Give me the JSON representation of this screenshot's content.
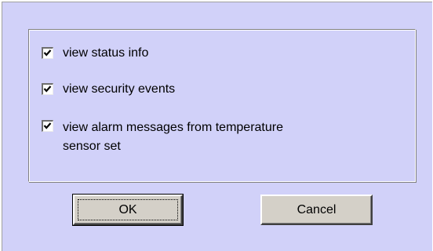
{
  "dialog": {
    "options": [
      {
        "label": "view status info",
        "checked": true
      },
      {
        "label": "view security events",
        "checked": true
      },
      {
        "label": "view alarm messages from temperature sensor set",
        "checked": true
      }
    ],
    "buttons": {
      "ok_label": "OK",
      "cancel_label": "Cancel"
    }
  },
  "colors": {
    "dialog_background": "#d1d1f9",
    "button_face": "#d4d0c8"
  }
}
